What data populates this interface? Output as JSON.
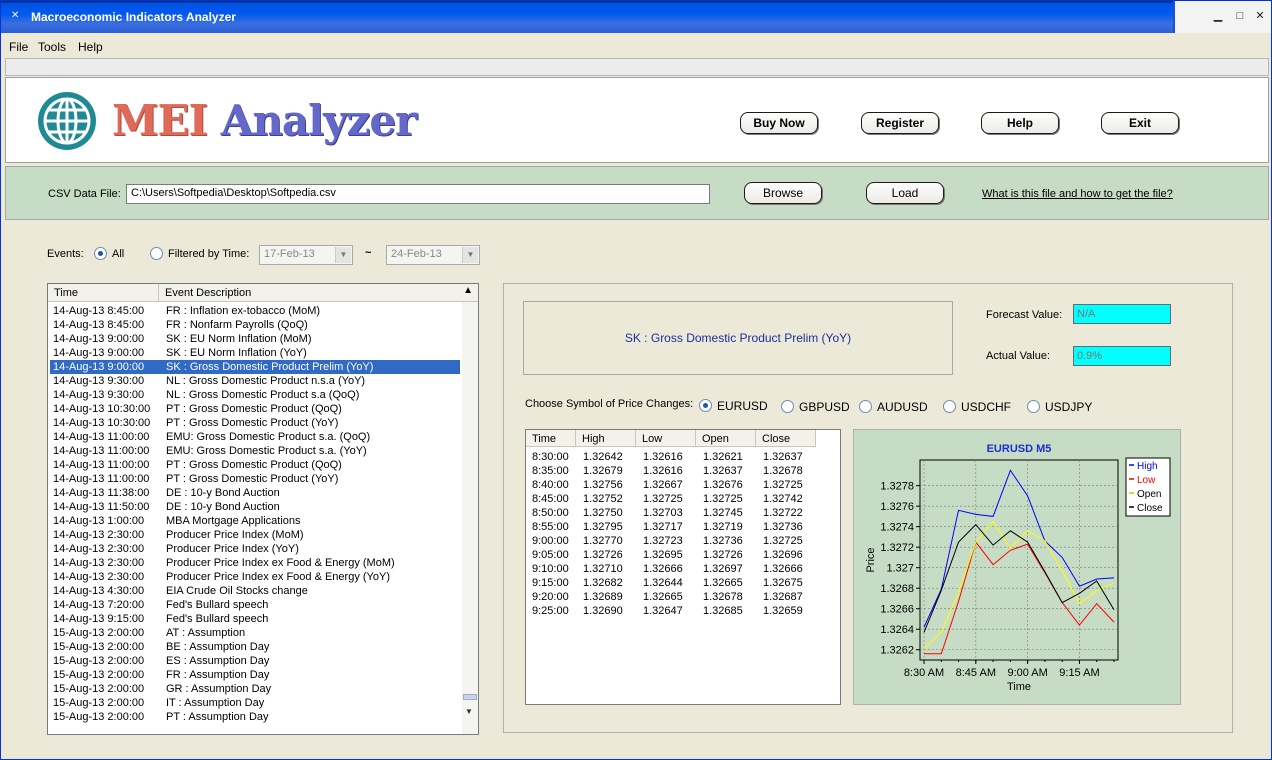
{
  "window": {
    "title": "Macroeconomic Indicators Analyzer",
    "controls": {
      "minimize": "▁",
      "maximize": "□",
      "close": "✕"
    }
  },
  "menu": {
    "items": [
      "File",
      "Tools",
      "Help"
    ]
  },
  "banner": {
    "logo_part1": "MEI",
    "logo_part2": "Analyzer",
    "buttons": {
      "buy_now": "Buy Now",
      "register": "Register",
      "help": "Help",
      "exit": "Exit"
    }
  },
  "csv": {
    "label": "CSV Data File:",
    "path": "C:\\Users\\Softpedia\\Desktop\\Softpedia.csv",
    "browse": "Browse",
    "load": "Load",
    "help_link": "What is this file and how to get the file?"
  },
  "events_filter": {
    "label": "Events:",
    "all_label": "All",
    "all_selected": true,
    "filtered_label": "Filtered by Time:",
    "from_date": "17-Feb-13",
    "separator": "~",
    "to_date": "24-Feb-13"
  },
  "events_list": {
    "columns": [
      "Time",
      "Event Description"
    ],
    "selected_index": 4,
    "rows": [
      [
        "14-Aug-13 8:45:00",
        "FR : Inflation ex-tobacco (MoM)"
      ],
      [
        "14-Aug-13 8:45:00",
        "FR : Nonfarm Payrolls (QoQ)"
      ],
      [
        "14-Aug-13 9:00:00",
        "SK : EU Norm Inflation (MoM)"
      ],
      [
        "14-Aug-13 9:00:00",
        "SK : EU Norm Inflation (YoY)"
      ],
      [
        "14-Aug-13 9:00:00",
        "SK : Gross Domestic Product Prelim (YoY)"
      ],
      [
        "14-Aug-13 9:30:00",
        "NL : Gross Domestic Product n.s.a (YoY)"
      ],
      [
        "14-Aug-13 9:30:00",
        "NL : Gross Domestic Product s.a (QoQ)"
      ],
      [
        "14-Aug-13 10:30:00",
        "PT : Gross Domestic Product (QoQ)"
      ],
      [
        "14-Aug-13 10:30:00",
        "PT : Gross Domestic Product (YoY)"
      ],
      [
        "14-Aug-13 11:00:00",
        "EMU: Gross Domestic Product s.a. (QoQ)"
      ],
      [
        "14-Aug-13 11:00:00",
        "EMU: Gross Domestic Product s.a. (YoY)"
      ],
      [
        "14-Aug-13 11:00:00",
        "PT : Gross Domestic Product (QoQ)"
      ],
      [
        "14-Aug-13 11:00:00",
        "PT : Gross Domestic Product (YoY)"
      ],
      [
        "14-Aug-13 11:38:00",
        "DE : 10-y Bond Auction"
      ],
      [
        "14-Aug-13 11:50:00",
        "DE : 10-y Bond Auction"
      ],
      [
        "14-Aug-13 1:00:00",
        "MBA Mortgage Applications"
      ],
      [
        "14-Aug-13 2:30:00",
        "Producer Price Index (MoM)"
      ],
      [
        "14-Aug-13 2:30:00",
        "Producer Price Index (YoY)"
      ],
      [
        "14-Aug-13 2:30:00",
        "Producer Price Index ex Food & Energy (MoM)"
      ],
      [
        "14-Aug-13 2:30:00",
        "Producer Price Index ex Food & Energy (YoY)"
      ],
      [
        "14-Aug-13 4:30:00",
        "EIA Crude Oil Stocks change"
      ],
      [
        "14-Aug-13 7:20:00",
        "Fed's Bullard speech"
      ],
      [
        "14-Aug-13 9:15:00",
        "Fed's Bullard speech"
      ],
      [
        "15-Aug-13 2:00:00",
        "AT : Assumption"
      ],
      [
        "15-Aug-13 2:00:00",
        "BE : Assumption Day"
      ],
      [
        "15-Aug-13 2:00:00",
        "ES : Assumption Day"
      ],
      [
        "15-Aug-13 2:00:00",
        "FR : Assumption Day"
      ],
      [
        "15-Aug-13 2:00:00",
        "GR : Assumption Day"
      ],
      [
        "15-Aug-13 2:00:00",
        "IT : Assumption Day"
      ],
      [
        "15-Aug-13 2:00:00",
        "PT : Assumption Day"
      ]
    ]
  },
  "detail": {
    "event_name": "SK : Gross Domestic Product Prelim (YoY)",
    "forecast_label": "Forecast Value:",
    "forecast_value": "N/A",
    "actual_label": "Actual Value:",
    "actual_value": "0.9%"
  },
  "symbols": {
    "label": "Choose Symbol of Price Changes:",
    "options": [
      "EURUSD",
      "GBPUSD",
      "AUDUSD",
      "USDCHF",
      "USDJPY"
    ],
    "selected_index": 0
  },
  "price_table": {
    "columns": [
      "Time",
      "High",
      "Low",
      "Open",
      "Close"
    ],
    "rows": [
      [
        "8:30:00",
        "1.32642",
        "1.32616",
        "1.32621",
        "1.32637"
      ],
      [
        "8:35:00",
        "1.32679",
        "1.32616",
        "1.32637",
        "1.32678"
      ],
      [
        "8:40:00",
        "1.32756",
        "1.32667",
        "1.32676",
        "1.32725"
      ],
      [
        "8:45:00",
        "1.32752",
        "1.32725",
        "1.32725",
        "1.32742"
      ],
      [
        "8:50:00",
        "1.32750",
        "1.32703",
        "1.32745",
        "1.32722"
      ],
      [
        "8:55:00",
        "1.32795",
        "1.32717",
        "1.32719",
        "1.32736"
      ],
      [
        "9:00:00",
        "1.32770",
        "1.32723",
        "1.32736",
        "1.32725"
      ],
      [
        "9:05:00",
        "1.32726",
        "1.32695",
        "1.32726",
        "1.32696"
      ],
      [
        "9:10:00",
        "1.32710",
        "1.32666",
        "1.32697",
        "1.32666"
      ],
      [
        "9:15:00",
        "1.32682",
        "1.32644",
        "1.32665",
        "1.32675"
      ],
      [
        "9:20:00",
        "1.32689",
        "1.32665",
        "1.32678",
        "1.32687"
      ],
      [
        "9:25:00",
        "1.32690",
        "1.32647",
        "1.32685",
        "1.32659"
      ]
    ]
  },
  "chart_data": {
    "type": "line",
    "title": "EURUSD M5",
    "xlabel": "Time",
    "ylabel": "Price",
    "x": [
      "8:30",
      "8:35",
      "8:40",
      "8:45",
      "8:50",
      "8:55",
      "9:00",
      "9:05",
      "9:10",
      "9:15",
      "9:20",
      "9:25"
    ],
    "x_tick_labels": [
      "8:30 AM",
      "8:45 AM",
      "9:00 AM",
      "9:15 AM"
    ],
    "y_tick_labels": [
      "1.3262",
      "1.3264",
      "1.3266",
      "1.3268",
      "1.327",
      "1.3272",
      "1.3274",
      "1.3276",
      "1.3278"
    ],
    "ylim": [
      1.3261,
      1.32805
    ],
    "grid": true,
    "legend_position": "top-right",
    "series": [
      {
        "name": "High",
        "color": "#0000ff",
        "values": [
          1.32642,
          1.32679,
          1.32756,
          1.32752,
          1.3275,
          1.32795,
          1.3277,
          1.32726,
          1.3271,
          1.32682,
          1.32689,
          1.3269
        ]
      },
      {
        "name": "Low",
        "color": "#ff0000",
        "values": [
          1.32616,
          1.32616,
          1.32667,
          1.32725,
          1.32703,
          1.32717,
          1.32723,
          1.32695,
          1.32666,
          1.32644,
          1.32665,
          1.32647
        ]
      },
      {
        "name": "Open",
        "color": "#ffff00",
        "values": [
          1.32621,
          1.32637,
          1.32676,
          1.32725,
          1.32745,
          1.32719,
          1.32736,
          1.32726,
          1.32697,
          1.32665,
          1.32678,
          1.32685
        ]
      },
      {
        "name": "Close",
        "color": "#000000",
        "values": [
          1.32637,
          1.32678,
          1.32725,
          1.32742,
          1.32722,
          1.32736,
          1.32725,
          1.32696,
          1.32666,
          1.32675,
          1.32687,
          1.32659
        ]
      }
    ]
  }
}
